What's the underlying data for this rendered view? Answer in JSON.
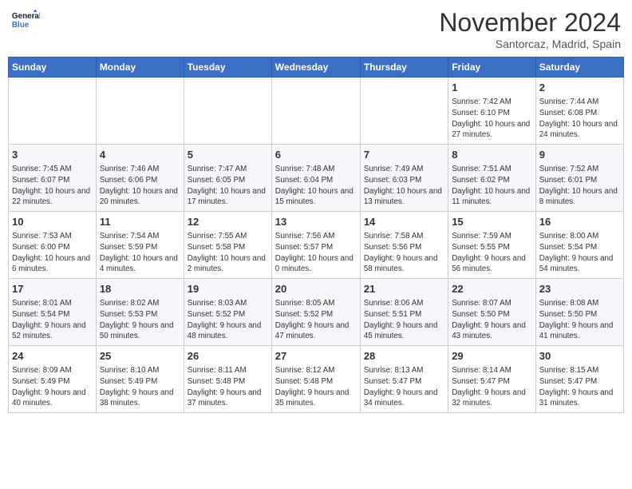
{
  "header": {
    "logo_line1": "General",
    "logo_line2": "Blue",
    "month_title": "November 2024",
    "location": "Santorcaz, Madrid, Spain"
  },
  "days_of_week": [
    "Sunday",
    "Monday",
    "Tuesday",
    "Wednesday",
    "Thursday",
    "Friday",
    "Saturday"
  ],
  "weeks": [
    [
      {
        "day": "",
        "sunrise": "",
        "sunset": "",
        "daylight": ""
      },
      {
        "day": "",
        "sunrise": "",
        "sunset": "",
        "daylight": ""
      },
      {
        "day": "",
        "sunrise": "",
        "sunset": "",
        "daylight": ""
      },
      {
        "day": "",
        "sunrise": "",
        "sunset": "",
        "daylight": ""
      },
      {
        "day": "",
        "sunrise": "",
        "sunset": "",
        "daylight": ""
      },
      {
        "day": "1",
        "sunrise": "Sunrise: 7:42 AM",
        "sunset": "Sunset: 6:10 PM",
        "daylight": "Daylight: 10 hours and 27 minutes."
      },
      {
        "day": "2",
        "sunrise": "Sunrise: 7:44 AM",
        "sunset": "Sunset: 6:08 PM",
        "daylight": "Daylight: 10 hours and 24 minutes."
      }
    ],
    [
      {
        "day": "3",
        "sunrise": "Sunrise: 7:45 AM",
        "sunset": "Sunset: 6:07 PM",
        "daylight": "Daylight: 10 hours and 22 minutes."
      },
      {
        "day": "4",
        "sunrise": "Sunrise: 7:46 AM",
        "sunset": "Sunset: 6:06 PM",
        "daylight": "Daylight: 10 hours and 20 minutes."
      },
      {
        "day": "5",
        "sunrise": "Sunrise: 7:47 AM",
        "sunset": "Sunset: 6:05 PM",
        "daylight": "Daylight: 10 hours and 17 minutes."
      },
      {
        "day": "6",
        "sunrise": "Sunrise: 7:48 AM",
        "sunset": "Sunset: 6:04 PM",
        "daylight": "Daylight: 10 hours and 15 minutes."
      },
      {
        "day": "7",
        "sunrise": "Sunrise: 7:49 AM",
        "sunset": "Sunset: 6:03 PM",
        "daylight": "Daylight: 10 hours and 13 minutes."
      },
      {
        "day": "8",
        "sunrise": "Sunrise: 7:51 AM",
        "sunset": "Sunset: 6:02 PM",
        "daylight": "Daylight: 10 hours and 11 minutes."
      },
      {
        "day": "9",
        "sunrise": "Sunrise: 7:52 AM",
        "sunset": "Sunset: 6:01 PM",
        "daylight": "Daylight: 10 hours and 8 minutes."
      }
    ],
    [
      {
        "day": "10",
        "sunrise": "Sunrise: 7:53 AM",
        "sunset": "Sunset: 6:00 PM",
        "daylight": "Daylight: 10 hours and 6 minutes."
      },
      {
        "day": "11",
        "sunrise": "Sunrise: 7:54 AM",
        "sunset": "Sunset: 5:59 PM",
        "daylight": "Daylight: 10 hours and 4 minutes."
      },
      {
        "day": "12",
        "sunrise": "Sunrise: 7:55 AM",
        "sunset": "Sunset: 5:58 PM",
        "daylight": "Daylight: 10 hours and 2 minutes."
      },
      {
        "day": "13",
        "sunrise": "Sunrise: 7:56 AM",
        "sunset": "Sunset: 5:57 PM",
        "daylight": "Daylight: 10 hours and 0 minutes."
      },
      {
        "day": "14",
        "sunrise": "Sunrise: 7:58 AM",
        "sunset": "Sunset: 5:56 PM",
        "daylight": "Daylight: 9 hours and 58 minutes."
      },
      {
        "day": "15",
        "sunrise": "Sunrise: 7:59 AM",
        "sunset": "Sunset: 5:55 PM",
        "daylight": "Daylight: 9 hours and 56 minutes."
      },
      {
        "day": "16",
        "sunrise": "Sunrise: 8:00 AM",
        "sunset": "Sunset: 5:54 PM",
        "daylight": "Daylight: 9 hours and 54 minutes."
      }
    ],
    [
      {
        "day": "17",
        "sunrise": "Sunrise: 8:01 AM",
        "sunset": "Sunset: 5:54 PM",
        "daylight": "Daylight: 9 hours and 52 minutes."
      },
      {
        "day": "18",
        "sunrise": "Sunrise: 8:02 AM",
        "sunset": "Sunset: 5:53 PM",
        "daylight": "Daylight: 9 hours and 50 minutes."
      },
      {
        "day": "19",
        "sunrise": "Sunrise: 8:03 AM",
        "sunset": "Sunset: 5:52 PM",
        "daylight": "Daylight: 9 hours and 48 minutes."
      },
      {
        "day": "20",
        "sunrise": "Sunrise: 8:05 AM",
        "sunset": "Sunset: 5:52 PM",
        "daylight": "Daylight: 9 hours and 47 minutes."
      },
      {
        "day": "21",
        "sunrise": "Sunrise: 8:06 AM",
        "sunset": "Sunset: 5:51 PM",
        "daylight": "Daylight: 9 hours and 45 minutes."
      },
      {
        "day": "22",
        "sunrise": "Sunrise: 8:07 AM",
        "sunset": "Sunset: 5:50 PM",
        "daylight": "Daylight: 9 hours and 43 minutes."
      },
      {
        "day": "23",
        "sunrise": "Sunrise: 8:08 AM",
        "sunset": "Sunset: 5:50 PM",
        "daylight": "Daylight: 9 hours and 41 minutes."
      }
    ],
    [
      {
        "day": "24",
        "sunrise": "Sunrise: 8:09 AM",
        "sunset": "Sunset: 5:49 PM",
        "daylight": "Daylight: 9 hours and 40 minutes."
      },
      {
        "day": "25",
        "sunrise": "Sunrise: 8:10 AM",
        "sunset": "Sunset: 5:49 PM",
        "daylight": "Daylight: 9 hours and 38 minutes."
      },
      {
        "day": "26",
        "sunrise": "Sunrise: 8:11 AM",
        "sunset": "Sunset: 5:48 PM",
        "daylight": "Daylight: 9 hours and 37 minutes."
      },
      {
        "day": "27",
        "sunrise": "Sunrise: 8:12 AM",
        "sunset": "Sunset: 5:48 PM",
        "daylight": "Daylight: 9 hours and 35 minutes."
      },
      {
        "day": "28",
        "sunrise": "Sunrise: 8:13 AM",
        "sunset": "Sunset: 5:47 PM",
        "daylight": "Daylight: 9 hours and 34 minutes."
      },
      {
        "day": "29",
        "sunrise": "Sunrise: 8:14 AM",
        "sunset": "Sunset: 5:47 PM",
        "daylight": "Daylight: 9 hours and 32 minutes."
      },
      {
        "day": "30",
        "sunrise": "Sunrise: 8:15 AM",
        "sunset": "Sunset: 5:47 PM",
        "daylight": "Daylight: 9 hours and 31 minutes."
      }
    ]
  ]
}
